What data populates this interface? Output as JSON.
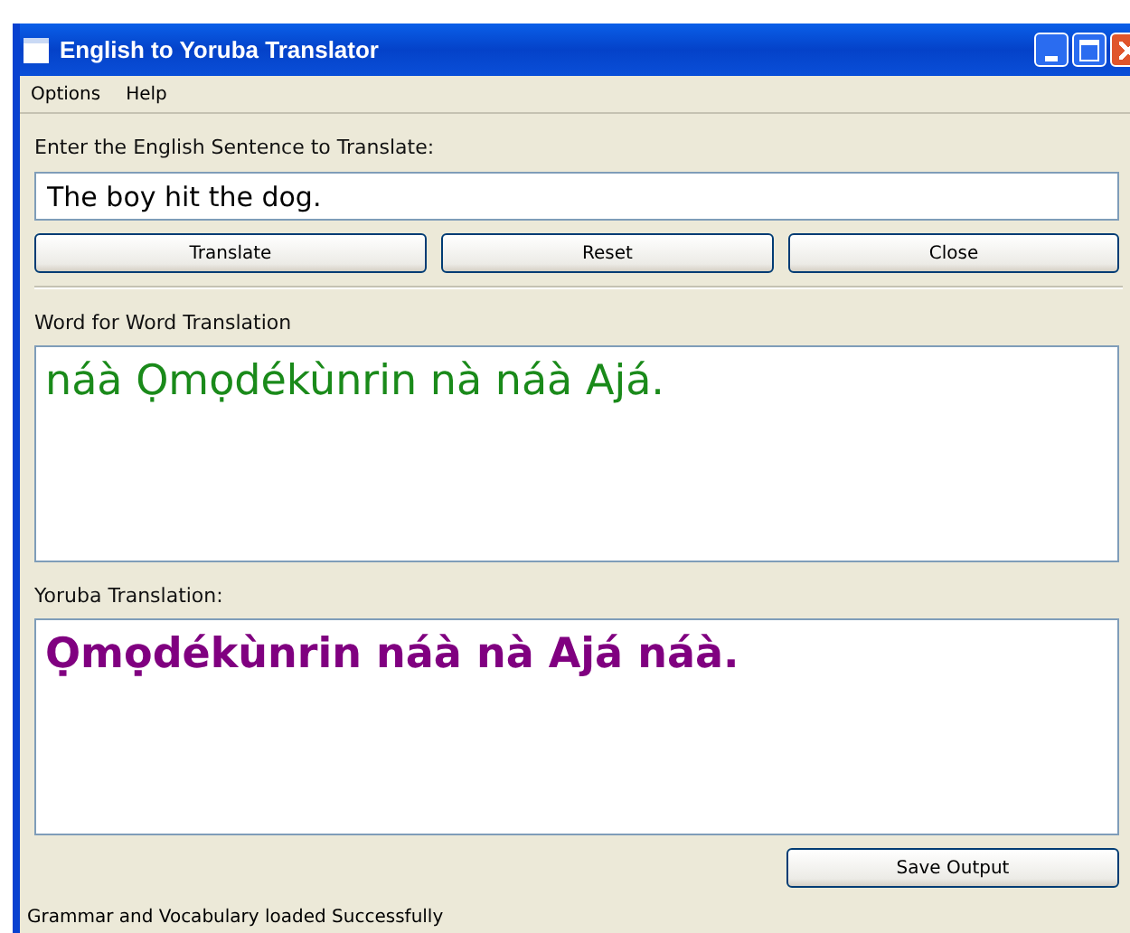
{
  "window": {
    "title": "English to Yoruba Translator"
  },
  "menu": [
    "Options",
    "Help"
  ],
  "input": {
    "label": "Enter the English Sentence to Translate:",
    "value": "The boy hit the dog."
  },
  "buttons": [
    "Translate",
    "Reset",
    "Close"
  ],
  "outputs": [
    {
      "kind": "plain",
      "label": "Word for Word Translation",
      "text": "náà Ọmọdékùnrin nà náà Ajá.",
      "color": "#1a8a1a"
    },
    {
      "kind": "bold",
      "label": "Yoruba Translation:",
      "text": "Ọmọdékùnrin náà nà Ajá náà.",
      "color": "#800080"
    }
  ],
  "save_button": "Save Output",
  "status_bar": "Grammar and Vocabulary loaded Successfully"
}
